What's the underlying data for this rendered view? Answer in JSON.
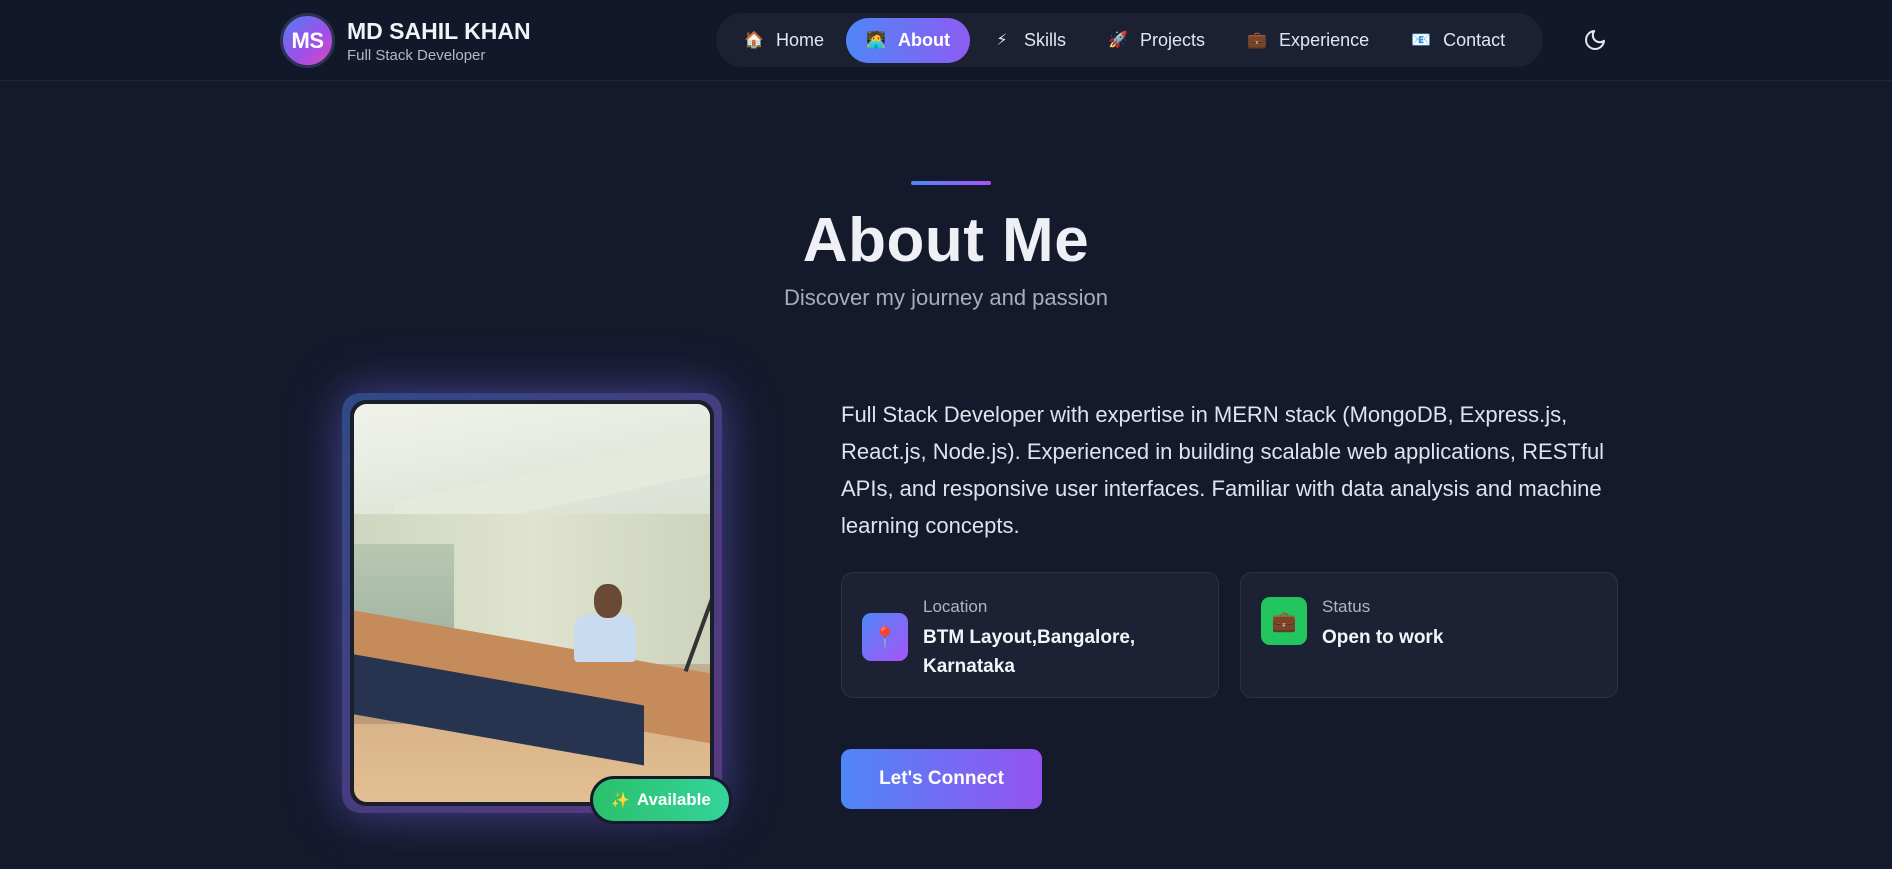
{
  "brand": {
    "initials": "MS",
    "name": "MD SAHIL KHAN",
    "tagline": "Full Stack Developer"
  },
  "nav": {
    "items": [
      {
        "label": "Home",
        "icon": "🏠",
        "icon_name": "home-icon",
        "active": false
      },
      {
        "label": "About",
        "icon": "🧑‍💻",
        "icon_name": "person-icon",
        "active": true
      },
      {
        "label": "Skills",
        "icon": "⚡",
        "icon_name": "lightning-icon",
        "active": false
      },
      {
        "label": "Projects",
        "icon": "🚀",
        "icon_name": "rocket-icon",
        "active": false
      },
      {
        "label": "Experience",
        "icon": "💼",
        "icon_name": "briefcase-icon",
        "active": false
      },
      {
        "label": "Contact",
        "icon": "📧",
        "icon_name": "envelope-icon",
        "active": false
      }
    ],
    "theme_toggle_icon": "moon-icon"
  },
  "section": {
    "title": "About Me",
    "subtitle": "Discover my journey and passion"
  },
  "photo": {
    "badge_icon": "✨",
    "badge_label": "Available"
  },
  "bio": "Full Stack Developer with expertise in MERN stack (MongoDB, Express.js, React.js, Node.js). Experienced in building scalable web applications, RESTful APIs, and responsive user interfaces. Familiar with data analysis and machine learning concepts.",
  "info": {
    "location": {
      "icon": "📍",
      "label": "Location",
      "value": "BTM Layout,Bangalore, Karnataka"
    },
    "status": {
      "icon": "💼",
      "label": "Status",
      "value": "Open to work"
    }
  },
  "cta": {
    "label": "Let's Connect"
  },
  "colors": {
    "background": "#141a2c",
    "accent_start": "#4f86f7",
    "accent_end": "#a855f7",
    "success": "#22c55e"
  }
}
